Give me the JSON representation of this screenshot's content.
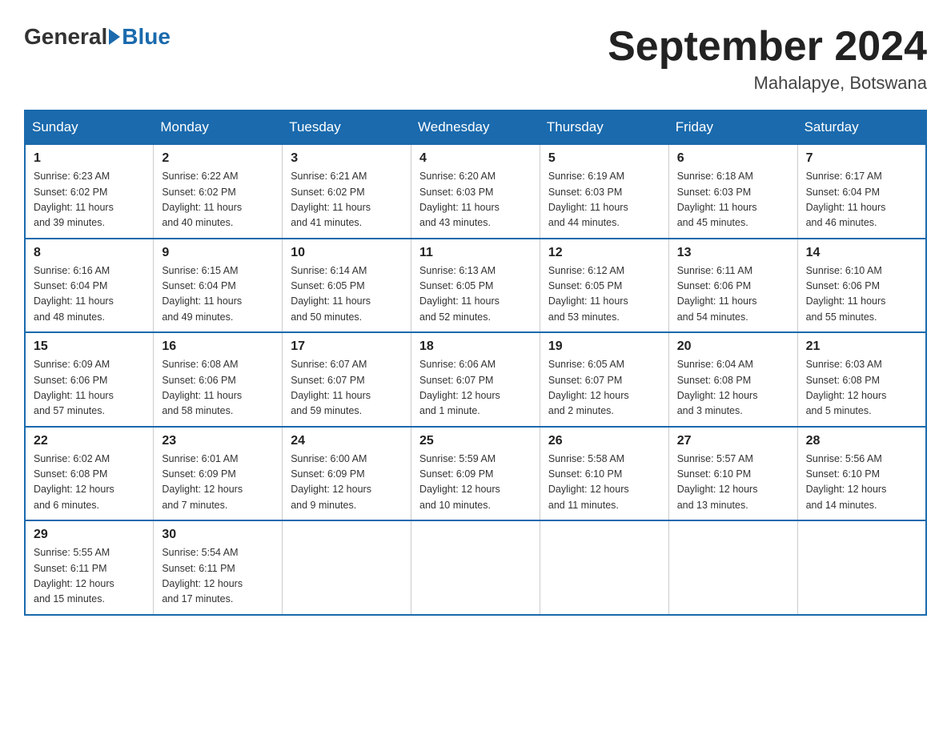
{
  "header": {
    "logo": {
      "general": "General",
      "blue": "Blue"
    },
    "title": "September 2024",
    "location": "Mahalapye, Botswana"
  },
  "calendar": {
    "days_of_week": [
      "Sunday",
      "Monday",
      "Tuesday",
      "Wednesday",
      "Thursday",
      "Friday",
      "Saturday"
    ],
    "weeks": [
      [
        {
          "day": "1",
          "sunrise": "6:23 AM",
          "sunset": "6:02 PM",
          "daylight": "11 hours and 39 minutes."
        },
        {
          "day": "2",
          "sunrise": "6:22 AM",
          "sunset": "6:02 PM",
          "daylight": "11 hours and 40 minutes."
        },
        {
          "day": "3",
          "sunrise": "6:21 AM",
          "sunset": "6:02 PM",
          "daylight": "11 hours and 41 minutes."
        },
        {
          "day": "4",
          "sunrise": "6:20 AM",
          "sunset": "6:03 PM",
          "daylight": "11 hours and 43 minutes."
        },
        {
          "day": "5",
          "sunrise": "6:19 AM",
          "sunset": "6:03 PM",
          "daylight": "11 hours and 44 minutes."
        },
        {
          "day": "6",
          "sunrise": "6:18 AM",
          "sunset": "6:03 PM",
          "daylight": "11 hours and 45 minutes."
        },
        {
          "day": "7",
          "sunrise": "6:17 AM",
          "sunset": "6:04 PM",
          "daylight": "11 hours and 46 minutes."
        }
      ],
      [
        {
          "day": "8",
          "sunrise": "6:16 AM",
          "sunset": "6:04 PM",
          "daylight": "11 hours and 48 minutes."
        },
        {
          "day": "9",
          "sunrise": "6:15 AM",
          "sunset": "6:04 PM",
          "daylight": "11 hours and 49 minutes."
        },
        {
          "day": "10",
          "sunrise": "6:14 AM",
          "sunset": "6:05 PM",
          "daylight": "11 hours and 50 minutes."
        },
        {
          "day": "11",
          "sunrise": "6:13 AM",
          "sunset": "6:05 PM",
          "daylight": "11 hours and 52 minutes."
        },
        {
          "day": "12",
          "sunrise": "6:12 AM",
          "sunset": "6:05 PM",
          "daylight": "11 hours and 53 minutes."
        },
        {
          "day": "13",
          "sunrise": "6:11 AM",
          "sunset": "6:06 PM",
          "daylight": "11 hours and 54 minutes."
        },
        {
          "day": "14",
          "sunrise": "6:10 AM",
          "sunset": "6:06 PM",
          "daylight": "11 hours and 55 minutes."
        }
      ],
      [
        {
          "day": "15",
          "sunrise": "6:09 AM",
          "sunset": "6:06 PM",
          "daylight": "11 hours and 57 minutes."
        },
        {
          "day": "16",
          "sunrise": "6:08 AM",
          "sunset": "6:06 PM",
          "daylight": "11 hours and 58 minutes."
        },
        {
          "day": "17",
          "sunrise": "6:07 AM",
          "sunset": "6:07 PM",
          "daylight": "11 hours and 59 minutes."
        },
        {
          "day": "18",
          "sunrise": "6:06 AM",
          "sunset": "6:07 PM",
          "daylight": "12 hours and 1 minute."
        },
        {
          "day": "19",
          "sunrise": "6:05 AM",
          "sunset": "6:07 PM",
          "daylight": "12 hours and 2 minutes."
        },
        {
          "day": "20",
          "sunrise": "6:04 AM",
          "sunset": "6:08 PM",
          "daylight": "12 hours and 3 minutes."
        },
        {
          "day": "21",
          "sunrise": "6:03 AM",
          "sunset": "6:08 PM",
          "daylight": "12 hours and 5 minutes."
        }
      ],
      [
        {
          "day": "22",
          "sunrise": "6:02 AM",
          "sunset": "6:08 PM",
          "daylight": "12 hours and 6 minutes."
        },
        {
          "day": "23",
          "sunrise": "6:01 AM",
          "sunset": "6:09 PM",
          "daylight": "12 hours and 7 minutes."
        },
        {
          "day": "24",
          "sunrise": "6:00 AM",
          "sunset": "6:09 PM",
          "daylight": "12 hours and 9 minutes."
        },
        {
          "day": "25",
          "sunrise": "5:59 AM",
          "sunset": "6:09 PM",
          "daylight": "12 hours and 10 minutes."
        },
        {
          "day": "26",
          "sunrise": "5:58 AM",
          "sunset": "6:10 PM",
          "daylight": "12 hours and 11 minutes."
        },
        {
          "day": "27",
          "sunrise": "5:57 AM",
          "sunset": "6:10 PM",
          "daylight": "12 hours and 13 minutes."
        },
        {
          "day": "28",
          "sunrise": "5:56 AM",
          "sunset": "6:10 PM",
          "daylight": "12 hours and 14 minutes."
        }
      ],
      [
        {
          "day": "29",
          "sunrise": "5:55 AM",
          "sunset": "6:11 PM",
          "daylight": "12 hours and 15 minutes."
        },
        {
          "day": "30",
          "sunrise": "5:54 AM",
          "sunset": "6:11 PM",
          "daylight": "12 hours and 17 minutes."
        },
        null,
        null,
        null,
        null,
        null
      ]
    ],
    "labels": {
      "sunrise": "Sunrise:",
      "sunset": "Sunset:",
      "daylight": "Daylight:"
    }
  }
}
